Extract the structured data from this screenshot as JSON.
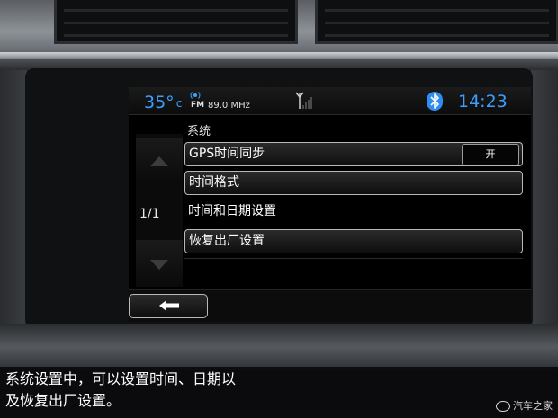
{
  "status_bar": {
    "temperature": "35°",
    "temperature_unit": "c",
    "radio_band": "FM",
    "radio_frequency": "89.0 MHz",
    "time": "14:23",
    "icons": [
      "radio-icon",
      "antenna-signal-icon",
      "bluetooth-icon"
    ]
  },
  "settings": {
    "section_title": "系统",
    "page_indicator": "1/1",
    "items": [
      {
        "label": "GPS时间同步",
        "toggle_value": "开"
      },
      {
        "label": "时间格式"
      },
      {
        "label": "时间和日期设置"
      },
      {
        "label": "恢复出厂设置"
      }
    ]
  },
  "navigation": {
    "icons": [
      "scroll-up-icon",
      "scroll-down-icon",
      "back-arrow-icon"
    ]
  },
  "caption": "系统设置中，可以设置时间、日期以及恢复出厂设置。",
  "watermark": "汽车之家",
  "colors": {
    "accent_blue": "#3aa0ff",
    "bluetooth_blue": "#2f8cf0",
    "screen_background": "#000000"
  }
}
